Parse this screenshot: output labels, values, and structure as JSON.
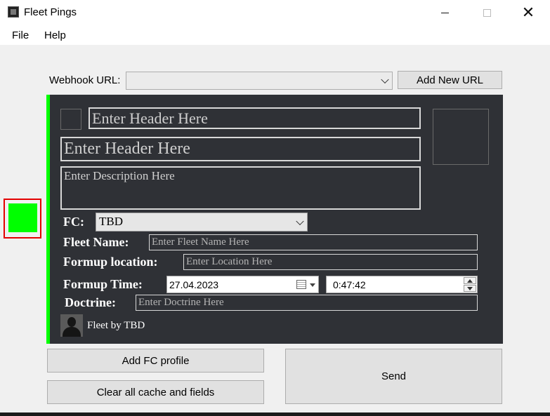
{
  "window": {
    "title": "Fleet Pings",
    "close_glyph": "✕"
  },
  "menu": {
    "items": [
      "File",
      "Help"
    ]
  },
  "webhook": {
    "label": "Webhook URL:",
    "value": "",
    "add_button": "Add New URL"
  },
  "embed": {
    "accent_color": "#00ff00",
    "author_placeholder": "Enter Header Here",
    "title_placeholder": "Enter Header Here",
    "description_placeholder": "Enter Description Here",
    "fc_label": "FC:",
    "fc_value": "TBD",
    "fleet_name_label": "Fleet Name:",
    "fleet_name_placeholder": "Enter Fleet Name Here",
    "formup_location_label": "Formup location:",
    "formup_location_placeholder": "Enter Location Here",
    "formup_time_label": "Formup Time:",
    "formup_date": "27.04.2023",
    "formup_time": "0:47:42",
    "doctrine_label": "Doctrine:",
    "doctrine_placeholder": "Enter Doctrine Here",
    "footer_text": "Fleet by TBD"
  },
  "buttons": {
    "add_fc": "Add FC profile",
    "clear": "Clear all cache and fields",
    "send": "Send"
  },
  "colors": {
    "picker": "#00ff00",
    "highlight": "#e30000",
    "panel": "#2f3136"
  }
}
